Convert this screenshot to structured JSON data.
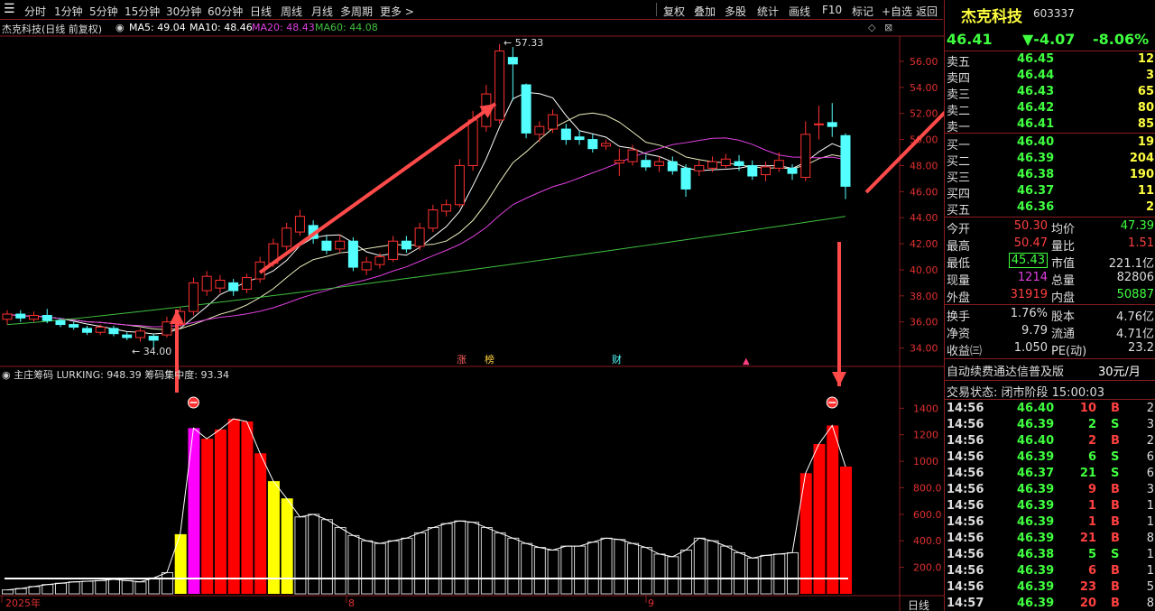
{
  "toolbar": {
    "periods": [
      "分时",
      "1分钟",
      "5分钟",
      "15分钟",
      "30分钟",
      "60分钟",
      "日线",
      "周线",
      "月线",
      "多周期",
      "更多 >"
    ],
    "actions": [
      "复权",
      "叠加",
      "多股",
      "统计",
      "画线",
      "F10",
      "标记",
      "+自选",
      "返回"
    ]
  },
  "chart_title": "杰克科技(日线 前复权)",
  "ma_legend": [
    {
      "label": "MA5: 49.04",
      "color": "#ffffff"
    },
    {
      "label": "MA10: 48.46",
      "color": "#ffffff"
    },
    {
      "label": "MA20: 48.43",
      "color": "#e040e0"
    },
    {
      "label": "MA60: 44.08",
      "color": "#40c040"
    }
  ],
  "indicator_title": "主庄筹码 LURKING: 948.39 筹码集中度: 93.34",
  "chart_data": [
    {
      "type": "candlestick",
      "title": "杰克科技(日线 前复权)",
      "y_ticks": [
        "56.00",
        "54.00",
        "52.00",
        "50.00",
        "48.00",
        "46.00",
        "44.00",
        "42.00",
        "40.00",
        "38.00",
        "36.00",
        "34.00"
      ],
      "ylim": [
        33,
        57.8
      ],
      "annotations": [
        "57.33",
        "34.00",
        "涨",
        "榜",
        "财"
      ],
      "candles": [
        {
          "o": 36.2,
          "c": 36.6,
          "h": 36.9,
          "l": 35.8
        },
        {
          "o": 36.6,
          "c": 36.3,
          "h": 36.9,
          "l": 36.0
        },
        {
          "o": 36.2,
          "c": 36.5,
          "h": 36.8,
          "l": 36.0
        },
        {
          "o": 36.5,
          "c": 36.1,
          "h": 37.0,
          "l": 35.9
        },
        {
          "o": 36.1,
          "c": 35.8,
          "h": 36.3,
          "l": 35.6
        },
        {
          "o": 35.8,
          "c": 35.6,
          "h": 36.0,
          "l": 35.4
        },
        {
          "o": 35.5,
          "c": 35.2,
          "h": 35.7,
          "l": 35.0
        },
        {
          "o": 35.2,
          "c": 35.6,
          "h": 35.8,
          "l": 35.0
        },
        {
          "o": 35.5,
          "c": 35.1,
          "h": 35.7,
          "l": 34.9
        },
        {
          "o": 35.0,
          "c": 34.8,
          "h": 35.2,
          "l": 34.6
        },
        {
          "o": 34.8,
          "c": 35.3,
          "h": 35.5,
          "l": 34.5
        },
        {
          "o": 34.9,
          "c": 34.6,
          "h": 35.1,
          "l": 34.0
        },
        {
          "o": 35.0,
          "c": 36.0,
          "h": 36.4,
          "l": 34.8
        },
        {
          "o": 35.8,
          "c": 36.8,
          "h": 37.1,
          "l": 35.6
        },
        {
          "o": 36.8,
          "c": 39.0,
          "h": 39.4,
          "l": 36.5
        },
        {
          "o": 38.4,
          "c": 39.5,
          "h": 39.9,
          "l": 38.0
        },
        {
          "o": 38.6,
          "c": 39.2,
          "h": 39.6,
          "l": 38.2
        },
        {
          "o": 39.0,
          "c": 38.4,
          "h": 39.3,
          "l": 38.0
        },
        {
          "o": 38.5,
          "c": 39.4,
          "h": 39.7,
          "l": 38.2
        },
        {
          "o": 39.3,
          "c": 40.6,
          "h": 41.0,
          "l": 39.0
        },
        {
          "o": 40.5,
          "c": 42.0,
          "h": 42.4,
          "l": 40.2
        },
        {
          "o": 41.8,
          "c": 43.2,
          "h": 43.6,
          "l": 41.5
        },
        {
          "o": 42.9,
          "c": 44.1,
          "h": 44.6,
          "l": 42.6
        },
        {
          "o": 43.4,
          "c": 42.4,
          "h": 43.8,
          "l": 42.0
        },
        {
          "o": 42.2,
          "c": 41.5,
          "h": 42.6,
          "l": 41.2
        },
        {
          "o": 41.6,
          "c": 42.2,
          "h": 42.7,
          "l": 41.3
        },
        {
          "o": 42.2,
          "c": 40.2,
          "h": 42.5,
          "l": 39.9
        },
        {
          "o": 40.0,
          "c": 40.6,
          "h": 41.0,
          "l": 39.6
        },
        {
          "o": 40.4,
          "c": 41.0,
          "h": 41.3,
          "l": 40.1
        },
        {
          "o": 40.8,
          "c": 42.2,
          "h": 42.6,
          "l": 40.6
        },
        {
          "o": 42.2,
          "c": 41.6,
          "h": 42.6,
          "l": 41.3
        },
        {
          "o": 41.8,
          "c": 43.2,
          "h": 43.6,
          "l": 41.5
        },
        {
          "o": 43.2,
          "c": 44.6,
          "h": 45.0,
          "l": 42.9
        },
        {
          "o": 44.5,
          "c": 45.0,
          "h": 45.4,
          "l": 44.1
        },
        {
          "o": 45.0,
          "c": 48.0,
          "h": 48.5,
          "l": 44.8
        },
        {
          "o": 48.0,
          "c": 51.5,
          "h": 52.2,
          "l": 47.6
        },
        {
          "o": 51.0,
          "c": 53.5,
          "h": 54.2,
          "l": 50.6
        },
        {
          "o": 51.5,
          "c": 56.8,
          "h": 57.33,
          "l": 51.2
        },
        {
          "o": 56.3,
          "c": 55.8,
          "h": 57.1,
          "l": 53.0
        },
        {
          "o": 54.2,
          "c": 50.5,
          "h": 54.3,
          "l": 50.1
        },
        {
          "o": 50.4,
          "c": 51.0,
          "h": 51.4,
          "l": 49.8
        },
        {
          "o": 50.8,
          "c": 51.9,
          "h": 52.3,
          "l": 50.5
        },
        {
          "o": 50.8,
          "c": 50.0,
          "h": 51.2,
          "l": 49.6
        },
        {
          "o": 50.2,
          "c": 50.0,
          "h": 50.7,
          "l": 49.6
        },
        {
          "o": 50.0,
          "c": 49.3,
          "h": 50.4,
          "l": 49.0
        },
        {
          "o": 49.5,
          "c": 49.7,
          "h": 50.0,
          "l": 49.2
        },
        {
          "o": 48.2,
          "c": 48.4,
          "h": 49.3,
          "l": 47.2
        },
        {
          "o": 48.3,
          "c": 49.2,
          "h": 49.6,
          "l": 48.0
        },
        {
          "o": 48.4,
          "c": 47.9,
          "h": 48.8,
          "l": 47.6
        },
        {
          "o": 48.0,
          "c": 48.3,
          "h": 48.7,
          "l": 47.5
        },
        {
          "o": 48.3,
          "c": 47.6,
          "h": 48.7,
          "l": 47.3
        },
        {
          "o": 47.8,
          "c": 46.2,
          "h": 48.1,
          "l": 45.6
        },
        {
          "o": 47.6,
          "c": 48.0,
          "h": 48.4,
          "l": 47.2
        },
        {
          "o": 47.8,
          "c": 48.3,
          "h": 48.7,
          "l": 47.5
        },
        {
          "o": 48.0,
          "c": 48.5,
          "h": 48.9,
          "l": 47.8
        },
        {
          "o": 48.3,
          "c": 48.0,
          "h": 48.8,
          "l": 47.6
        },
        {
          "o": 48.0,
          "c": 47.2,
          "h": 48.4,
          "l": 46.9
        },
        {
          "o": 47.3,
          "c": 47.9,
          "h": 48.3,
          "l": 46.8
        },
        {
          "o": 47.8,
          "c": 48.4,
          "h": 49.0,
          "l": 47.5
        },
        {
          "o": 47.8,
          "c": 47.4,
          "h": 48.1,
          "l": 46.9
        },
        {
          "o": 47.1,
          "c": 50.4,
          "h": 51.4,
          "l": 46.8
        },
        {
          "o": 51.2,
          "c": 51.2,
          "h": 52.6,
          "l": 50.0
        },
        {
          "o": 51.3,
          "c": 51.0,
          "h": 52.8,
          "l": 50.2
        },
        {
          "o": 50.3,
          "c": 46.41,
          "h": 50.47,
          "l": 45.43
        }
      ]
    },
    {
      "type": "bar",
      "title": "主庄筹码",
      "y_ticks": [
        "1400",
        "1200",
        "1000",
        "800.0",
        "600.0",
        "400.0",
        "200.0"
      ],
      "ylim": [
        0,
        1620
      ],
      "x_labels": [
        "2025年",
        "8",
        "9"
      ],
      "values": [
        30,
        40,
        55,
        70,
        80,
        90,
        95,
        100,
        110,
        100,
        90,
        120,
        160,
        450,
        1250,
        1170,
        1240,
        1320,
        1300,
        1060,
        850,
        720,
        580,
        600,
        560,
        500,
        440,
        400,
        380,
        400,
        420,
        460,
        500,
        530,
        550,
        540,
        500,
        460,
        420,
        380,
        350,
        330,
        360,
        360,
        390,
        420,
        410,
        380,
        350,
        300,
        280,
        330,
        420,
        400,
        360,
        310,
        270,
        290,
        300,
        310,
        910,
        1130,
        1270,
        960
      ],
      "highlight_colors": {
        "13": "#ffff00",
        "14": "#ff00ff",
        "15": "#ff0000",
        "16": "#ff0000",
        "17": "#ff0000",
        "18": "#ff0000",
        "19": "#ff0000",
        "20": "#ffff00",
        "21": "#ffff00",
        "60": "#ff0000",
        "61": "#ff0000",
        "62": "#ff0000",
        "63": "#ff0000"
      }
    }
  ],
  "right_panel": {
    "stock_name": "杰克科技",
    "stock_code": "603337",
    "price": "46.41",
    "change": "▼-4.07",
    "change_pct": "-8.06%",
    "asks": [
      {
        "label": "卖五",
        "price": "46.45",
        "vol": "12"
      },
      {
        "label": "卖四",
        "price": "46.44",
        "vol": "3"
      },
      {
        "label": "卖三",
        "price": "46.43",
        "vol": "65"
      },
      {
        "label": "卖二",
        "price": "46.42",
        "vol": "80"
      },
      {
        "label": "卖一",
        "price": "46.41",
        "vol": "85"
      }
    ],
    "bids": [
      {
        "label": "买一",
        "price": "46.40",
        "vol": "19"
      },
      {
        "label": "买二",
        "price": "46.39",
        "vol": "204"
      },
      {
        "label": "买三",
        "price": "46.38",
        "vol": "190"
      },
      {
        "label": "买四",
        "price": "46.37",
        "vol": "11"
      },
      {
        "label": "买五",
        "price": "46.36",
        "vol": "2"
      }
    ],
    "stats": [
      {
        "l1": "今开",
        "v1": "50.30",
        "c1": "#ff4040",
        "l2": "均价",
        "v2": "47.39",
        "c2": "#40ff40"
      },
      {
        "l1": "最高",
        "v1": "50.47",
        "c1": "#ff4040",
        "l2": "量比",
        "v2": "1.51",
        "c2": "#ff4040"
      },
      {
        "l1": "最低",
        "v1": "45.43",
        "c1": "#40ff40",
        "l2": "市值",
        "v2": "221.1亿",
        "c2": "#dddddd"
      },
      {
        "l1": "现量",
        "v1": "1214",
        "c1": "#e040e0",
        "l2": "总量",
        "v2": "82806",
        "c2": "#dddddd"
      },
      {
        "l1": "外盘",
        "v1": "31919",
        "c1": "#ff4040",
        "l2": "内盘",
        "v2": "50887",
        "c2": "#40ff40"
      }
    ],
    "stats2": [
      {
        "l1": "换手",
        "v1": "1.76%",
        "l2": "股本",
        "v2": "4.76亿"
      },
      {
        "l1": "净资",
        "v1": "9.79",
        "l2": "流通",
        "v2": "4.71亿"
      },
      {
        "l1": "收益㈢",
        "v1": "1.050",
        "l2": "PE(动)",
        "v2": "23.2"
      }
    ],
    "promo": "自动续费通达信普及版",
    "promo_price": "30元/月",
    "trade_status": "交易状态: 闭市阶段 15:00:03",
    "ticks": [
      {
        "t": "14:56",
        "p": "46.40",
        "v": "10",
        "s": "B"
      },
      {
        "t": "14:56",
        "p": "46.39",
        "v": "2",
        "s": "S"
      },
      {
        "t": "14:56",
        "p": "46.40",
        "v": "2",
        "s": "B"
      },
      {
        "t": "14:56",
        "p": "46.39",
        "v": "6",
        "s": "S"
      },
      {
        "t": "14:56",
        "p": "46.37",
        "v": "21",
        "s": "S"
      },
      {
        "t": "14:56",
        "p": "46.39",
        "v": "9",
        "s": "B"
      },
      {
        "t": "14:56",
        "p": "46.39",
        "v": "1",
        "s": "B"
      },
      {
        "t": "14:56",
        "p": "46.39",
        "v": "1",
        "s": "B"
      },
      {
        "t": "14:56",
        "p": "46.39",
        "v": "21",
        "s": "B"
      },
      {
        "t": "14:56",
        "p": "46.38",
        "v": "5",
        "s": "S"
      },
      {
        "t": "14:56",
        "p": "46.39",
        "v": "6",
        "s": "B"
      },
      {
        "t": "14:56",
        "p": "46.39",
        "v": "23",
        "s": "B"
      },
      {
        "t": "14:57",
        "p": "46.39",
        "v": "20",
        "s": "B"
      }
    ],
    "tick_tail": [
      "2",
      "3",
      "2",
      "6",
      "6",
      "3",
      "1",
      "1",
      "8",
      "1",
      "1",
      "5",
      "8"
    ]
  },
  "bottom_tab": "日线",
  "colors": {
    "up": "#ff3030",
    "down": "#54ffff",
    "ma5": "#ffffff",
    "ma10": "#f0f0c0",
    "ma20": "#e040e0",
    "ma60": "#40c040",
    "arrow": "#ff4a4a"
  }
}
